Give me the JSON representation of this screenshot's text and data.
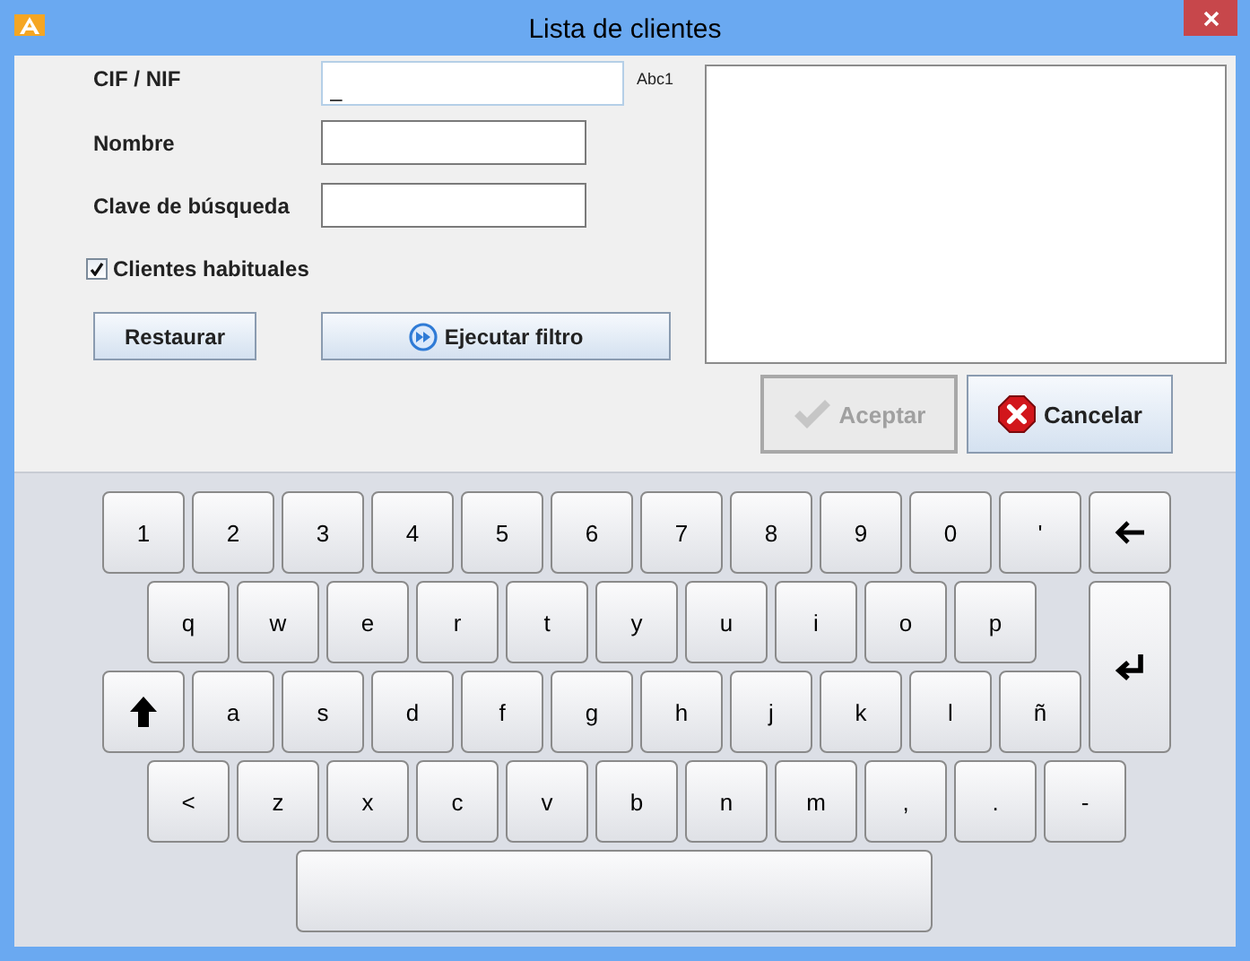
{
  "window": {
    "title": "Lista de clientes"
  },
  "form": {
    "fields": [
      {
        "label": "CIF / NIF",
        "value": "_",
        "focused": true,
        "mode": "Abc1"
      },
      {
        "label": "Nombre",
        "focused": false
      },
      {
        "label": "Clave de búsqueda",
        "focused": false
      }
    ],
    "checkbox": {
      "label": "Clientes habituales",
      "checked": true
    },
    "buttons": [
      {
        "label": "Restaurar",
        "kind": "plain",
        "disabled": false
      },
      {
        "label": "Ejecutar filtro",
        "kind": "run",
        "disabled": false
      }
    ]
  },
  "dialog_buttons": [
    {
      "label": "Aceptar",
      "kind": "accept",
      "disabled": true
    },
    {
      "label": "Cancelar",
      "kind": "cancel",
      "disabled": false
    }
  ],
  "keyboard": {
    "rows": [
      [
        {
          "kind": "char",
          "label": "1"
        },
        {
          "kind": "char",
          "label": "2"
        },
        {
          "kind": "char",
          "label": "3"
        },
        {
          "kind": "char",
          "label": "4"
        },
        {
          "kind": "char",
          "label": "5"
        },
        {
          "kind": "char",
          "label": "6"
        },
        {
          "kind": "char",
          "label": "7"
        },
        {
          "kind": "char",
          "label": "8"
        },
        {
          "kind": "char",
          "label": "9"
        },
        {
          "kind": "char",
          "label": "0"
        },
        {
          "kind": "char",
          "label": "'"
        },
        {
          "kind": "backspace"
        }
      ],
      [
        {
          "kind": "char",
          "label": "q"
        },
        {
          "kind": "char",
          "label": "w"
        },
        {
          "kind": "char",
          "label": "e"
        },
        {
          "kind": "char",
          "label": "r"
        },
        {
          "kind": "char",
          "label": "t"
        },
        {
          "kind": "char",
          "label": "y"
        },
        {
          "kind": "char",
          "label": "u"
        },
        {
          "kind": "char",
          "label": "i"
        },
        {
          "kind": "char",
          "label": "o"
        },
        {
          "kind": "char",
          "label": "p"
        },
        {
          "kind": "enter"
        }
      ],
      [
        {
          "kind": "shift"
        },
        {
          "kind": "char",
          "label": "a"
        },
        {
          "kind": "char",
          "label": "s"
        },
        {
          "kind": "char",
          "label": "d"
        },
        {
          "kind": "char",
          "label": "f"
        },
        {
          "kind": "char",
          "label": "g"
        },
        {
          "kind": "char",
          "label": "h"
        },
        {
          "kind": "char",
          "label": "j"
        },
        {
          "kind": "char",
          "label": "k"
        },
        {
          "kind": "char",
          "label": "l"
        },
        {
          "kind": "char",
          "label": "ñ"
        }
      ],
      [
        {
          "kind": "char",
          "label": "<"
        },
        {
          "kind": "char",
          "label": "z"
        },
        {
          "kind": "char",
          "label": "x"
        },
        {
          "kind": "char",
          "label": "c"
        },
        {
          "kind": "char",
          "label": "v"
        },
        {
          "kind": "char",
          "label": "b"
        },
        {
          "kind": "char",
          "label": "n"
        },
        {
          "kind": "char",
          "label": "m"
        },
        {
          "kind": "char",
          "label": ","
        },
        {
          "kind": "char",
          "label": "."
        },
        {
          "kind": "char",
          "label": "-"
        }
      ],
      [
        {
          "kind": "space"
        }
      ]
    ]
  }
}
